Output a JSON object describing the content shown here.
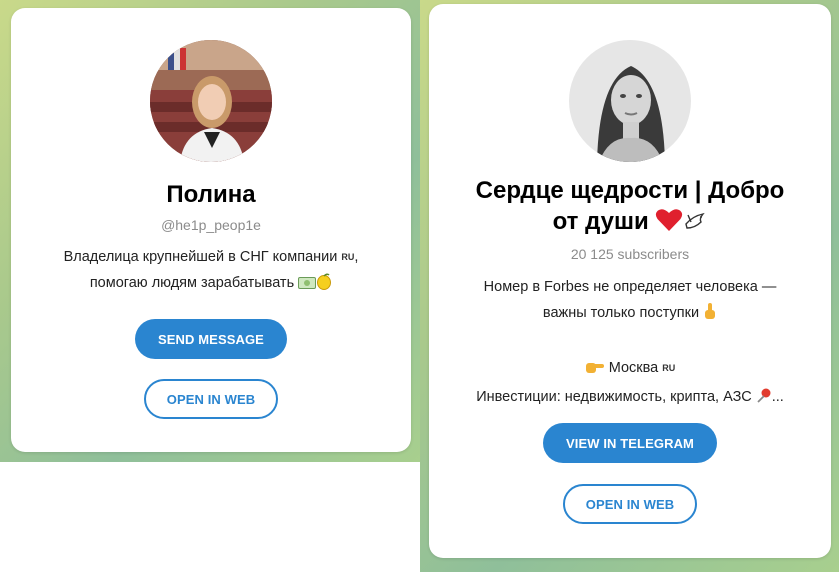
{
  "left_card": {
    "name": "Полина",
    "username": "@he1p_peop1e",
    "description_line1": "Владелица крупнейшей в СНГ компании",
    "description_flag": "RU",
    "description_line2": "помогаю людям зарабатывать",
    "send_button": "SEND MESSAGE",
    "web_button": "OPEN IN WEB"
  },
  "right_card": {
    "title_line1": "Сердце щедрости | Добро",
    "title_line2": "от души",
    "subscribers": "20 125 subscribers",
    "desc_line1": "Номер в Forbes не определяет человека —",
    "desc_line2": "важны только поступки",
    "city": "Москва",
    "city_flag": "RU",
    "interests": "Инвестиции: недвижимость, крипта, АЗС",
    "ellipsis": "...",
    "telegram_button": "VIEW IN TELEGRAM",
    "web_button": "OPEN IN WEB"
  },
  "colors": {
    "accent": "#2a85d0",
    "muted": "#8b8b8b"
  }
}
